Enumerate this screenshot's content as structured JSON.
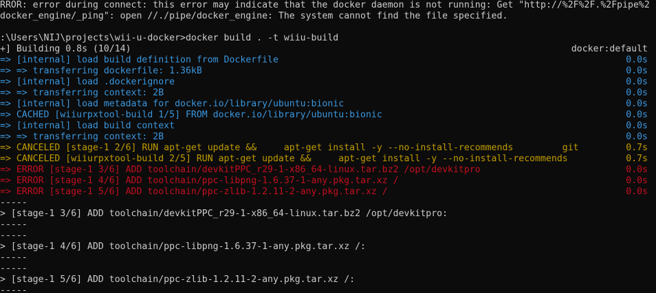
{
  "terminal": {
    "error_line_1": "RROR: error during connect: this error may indicate that the docker daemon is not running: Get \"http://%2F%2F.%2Fpipe%2",
    "error_line_2": "docker_engine/_ping\": open //./pipe/docker_engine: The system cannot find the file specified.",
    "prompt": ":\\Users\\NIJ\\projects\\wii-u-docker>docker build . -t wiiu-build",
    "building": {
      "text": "+] Building 0.8s (10/14)",
      "context": "docker:default"
    },
    "steps": [
      {
        "text": "=> [internal] load build definition from Dockerfile",
        "time": "0.0s",
        "status": "done"
      },
      {
        "text": "=> => transferring dockerfile: 1.36kB",
        "time": "0.0s",
        "status": "done"
      },
      {
        "text": "=> [internal] load .dockerignore",
        "time": "0.0s",
        "status": "done"
      },
      {
        "text": "=> => transferring context: 2B",
        "time": "0.0s",
        "status": "done"
      },
      {
        "text": "=> [internal] load metadata for docker.io/library/ubuntu:bionic",
        "time": "0.0s",
        "status": "done"
      },
      {
        "text": "=> CACHED [wiiurpxtool-build 1/5] FROM docker.io/library/ubuntu:bionic",
        "time": "0.0s",
        "status": "done"
      },
      {
        "text": "=> [internal] load build context",
        "time": "0.0s",
        "status": "done"
      },
      {
        "text": "=> => transferring context: 2B",
        "time": "0.0s",
        "status": "done"
      },
      {
        "text": "=> CANCELED [stage-1 2/6] RUN apt-get update &&     apt-get install -y --no-install-recommends         git",
        "time": "0.7s",
        "status": "canceled"
      },
      {
        "text": "=> CANCELED [wiiurpxtool-build 2/5] RUN apt-get update &&     apt-get install -y --no-install-recommends",
        "time": "0.7s",
        "status": "canceled"
      },
      {
        "text": "=> ERROR [stage-1 3/6] ADD toolchain/devkitPPC_r29-1-x86_64-linux.tar.bz2 /opt/devkitpro",
        "time": "0.0s",
        "status": "error"
      },
      {
        "text": "=> ERROR [stage-1 4/6] ADD toolchain/ppc-libpng-1.6.37-1-any.pkg.tar.xz /",
        "time": "0.0s",
        "status": "error"
      },
      {
        "text": "=> ERROR [stage-1 5/6] ADD toolchain/ppc-zlib-1.2.11-2-any.pkg.tar.xz /",
        "time": "0.0s",
        "status": "error"
      }
    ],
    "details": [
      "-----",
      "> [stage-1 3/6] ADD toolchain/devkitPPC_r29-1-x86_64-linux.tar.bz2 /opt/devkitpro:",
      "-----",
      "-----",
      "> [stage-1 4/6] ADD toolchain/ppc-libpng-1.6.37-1-any.pkg.tar.xz /:",
      "-----",
      "-----",
      "> [stage-1 5/6] ADD toolchain/ppc-zlib-1.2.11-2-any.pkg.tar.xz /:",
      "-----"
    ],
    "colors": {
      "background": "#0c0c0c",
      "text": "#cccccc",
      "done": "#3a96dd",
      "canceled": "#c19c00",
      "error": "#c50f1f"
    }
  }
}
